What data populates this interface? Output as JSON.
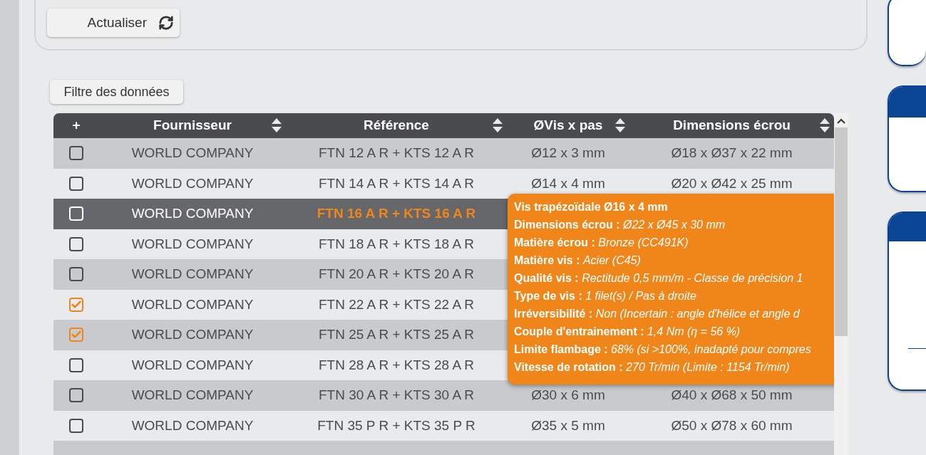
{
  "refresh_button": {
    "label": "Actualiser"
  },
  "filter_button": {
    "label": "Filtre des données"
  },
  "table": {
    "columns": [
      {
        "label": "+",
        "sortable": false
      },
      {
        "label": "Fournisseur",
        "sortable": true
      },
      {
        "label": "Référence",
        "sortable": true
      },
      {
        "label": "ØVis x pas",
        "sortable": true
      },
      {
        "label": "Dimensions écrou",
        "sortable": true
      }
    ],
    "rows": [
      {
        "checked": false,
        "selected": false,
        "supplier": "WORLD COMPANY",
        "reference": "FTN 12 A R + KTS 12 A R",
        "screw": "Ø12 x 3 mm",
        "nut": "Ø18 x Ø37 x 22 mm"
      },
      {
        "checked": false,
        "selected": false,
        "supplier": "WORLD COMPANY",
        "reference": "FTN 14 A R + KTS 14 A R",
        "screw": "Ø14 x 4 mm",
        "nut": "Ø20 x Ø42 x 25 mm"
      },
      {
        "checked": false,
        "selected": true,
        "supplier": "WORLD COMPANY",
        "reference": "FTN 16 A R + KTS 16 A R"
      },
      {
        "checked": false,
        "selected": false,
        "supplier": "WORLD COMPANY",
        "reference": "FTN 18 A R + KTS 18 A R"
      },
      {
        "checked": false,
        "selected": false,
        "supplier": "WORLD COMPANY",
        "reference": "FTN 20 A R + KTS 20 A R"
      },
      {
        "checked": true,
        "selected": false,
        "supplier": "WORLD COMPANY",
        "reference": "FTN 22 A R + KTS 22 A R"
      },
      {
        "checked": true,
        "selected": false,
        "supplier": "WORLD COMPANY",
        "reference": "FTN 25 A R + KTS 25 A R"
      },
      {
        "checked": false,
        "selected": false,
        "supplier": "WORLD COMPANY",
        "reference": "FTN 28 A R + KTS 28 A R"
      },
      {
        "checked": false,
        "selected": false,
        "supplier": "WORLD COMPANY",
        "reference": "FTN 30 A R + KTS 30 A R",
        "screw": "Ø30 x 6 mm",
        "nut": "Ø40 x Ø68 x 50 mm"
      },
      {
        "checked": false,
        "selected": false,
        "supplier": "WORLD COMPANY",
        "reference": "FTN 35 P R + KTS 35 P R",
        "screw": "Ø35 x 5 mm",
        "nut": "Ø50 x Ø78 x 60 mm"
      }
    ]
  },
  "tooltip": {
    "title": "Vis trapézoïdale Ø16 x 4 mm",
    "lines": [
      {
        "label": "Dimensions écrou :",
        "value": "Ø22 x Ø45 x 30 mm"
      },
      {
        "label": "Matière écrou :",
        "value": "Bronze (CC491K)"
      },
      {
        "label": "Matière vis :",
        "value": "Acier (C45)"
      },
      {
        "label": "Qualité vis :",
        "value": "Rectitude 0,5 mm/m - Classe de précision 1"
      },
      {
        "label": "Type de vis :",
        "value": "1 filet(s) / Pas à droite"
      },
      {
        "label": "Irréversibilité :",
        "value": "Non (Incertain : angle d'hélice et angle d"
      },
      {
        "label": "Couple d'entrainement :",
        "value": "1,4 Nm (η = 56 %)"
      },
      {
        "label": "Limite flambage :",
        "value": "68% (si >100%, inadapté pour compres"
      },
      {
        "label": "Vitesse de rotation :",
        "value": "270 Tr/min (Limite : 1154 Tr/min)"
      }
    ]
  }
}
